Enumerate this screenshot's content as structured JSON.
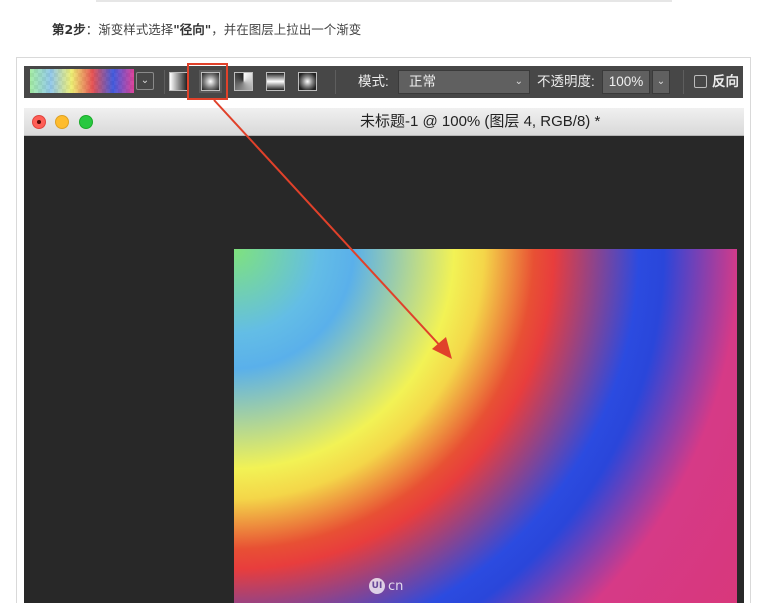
{
  "instruction": {
    "step_label": "第2步",
    "colon": "：",
    "text_before": "渐变样式选择",
    "emphasis": "\"径向\"",
    "text_after": "，并在图层上拉出一个渐变"
  },
  "options_bar": {
    "gradient_dropdown_icon": "chevron-down-icon",
    "gradient_types": [
      "linear",
      "radial",
      "angle",
      "reflected",
      "diamond"
    ],
    "selected_gradient_type": "radial",
    "mode_label": "模式:",
    "mode_value": "正常",
    "opacity_label": "不透明度:",
    "opacity_value": "100%",
    "reverse_label": "反向",
    "reverse_checked": false
  },
  "document_window": {
    "title": "未标题-1 @ 100% (图层 4, RGB/8) *"
  },
  "watermark": {
    "logo_text": "UI",
    "text": "cn"
  },
  "colors": {
    "highlight": "#e0412a",
    "toolbar_bg": "#474747",
    "canvas_bg": "#282828",
    "gradient_stops": [
      "#7fe27d",
      "#5ab0ea",
      "#f2f255",
      "#e83d3d",
      "#2a46da",
      "#d63a87"
    ]
  }
}
